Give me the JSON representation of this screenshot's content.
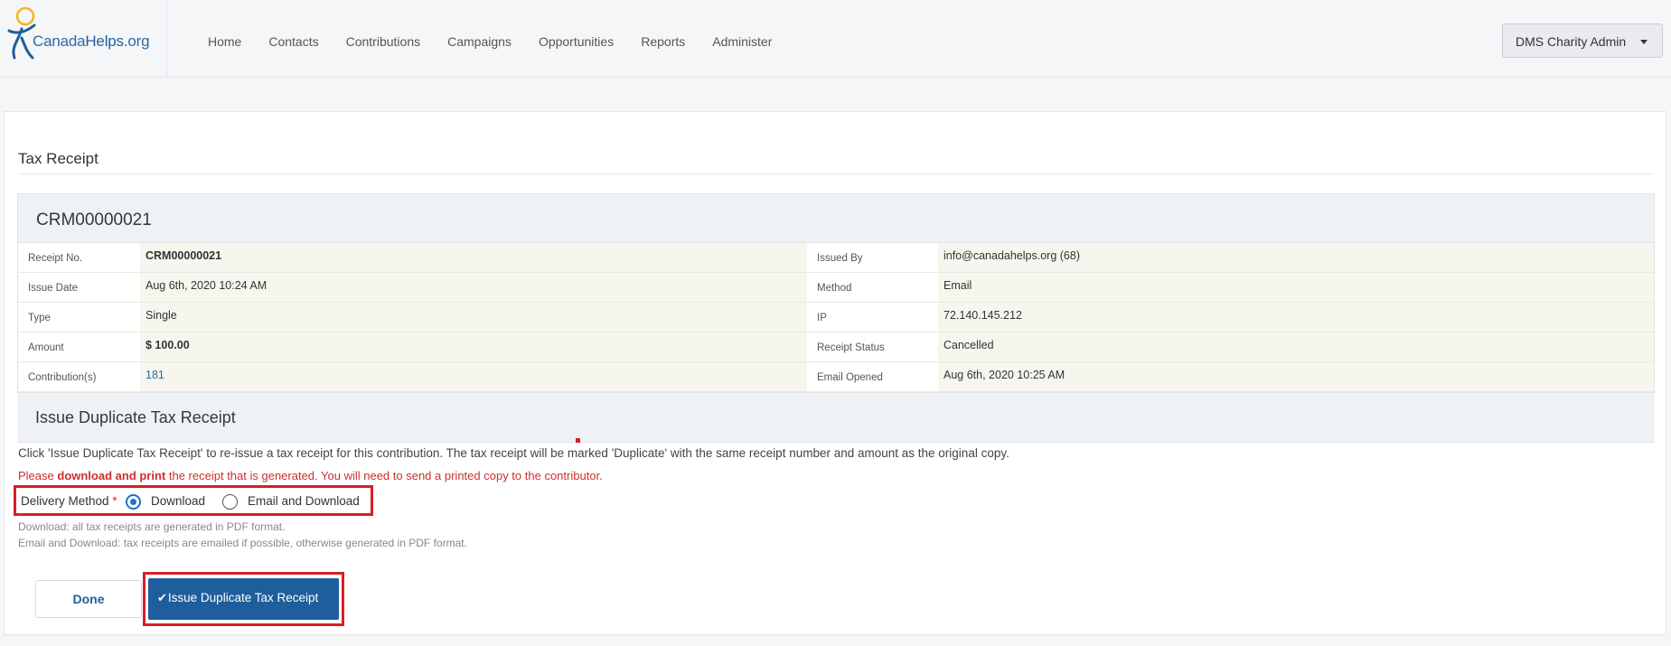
{
  "brand": {
    "logo_text_a": "Canada",
    "logo_text_b": "Helps",
    "logo_text_c": ".org"
  },
  "nav": [
    "Home",
    "Contacts",
    "Contributions",
    "Campaigns",
    "Opportunities",
    "Reports",
    "Administer"
  ],
  "user_menu": {
    "label": "DMS Charity Admin"
  },
  "page": {
    "title": "Tax Receipt"
  },
  "receipt": {
    "id": "CRM00000021",
    "rows": [
      {
        "label": "Receipt No.",
        "value": "CRM00000021",
        "label2": "Issued By",
        "value2": "info@canadahelps.org (68)"
      },
      {
        "label": "Issue Date",
        "value": "Aug 6th, 2020 10:24 AM",
        "label2": "Method",
        "value2": "Email"
      },
      {
        "label": "Type",
        "value": "Single",
        "label2": "IP",
        "value2": "72.140.145.212"
      },
      {
        "label": "Amount",
        "value": "$ 100.00",
        "label2": "Receipt Status",
        "value2": "Cancelled"
      },
      {
        "label": "Contribution(s)",
        "value": "181",
        "label2": "Email Opened",
        "value2": "Aug 6th, 2020 10:25 AM"
      }
    ]
  },
  "duplicate": {
    "title": "Issue Duplicate Tax Receipt",
    "description": "Click 'Issue Duplicate Tax Receipt' to re-issue a tax receipt for this contribution. The tax receipt will be marked 'Duplicate' with the same receipt number and amount as the original copy.",
    "warning_prefix": "Please ",
    "warning_bold": "download and print",
    "warning_suffix": " the receipt that is generated. You will need to send a printed copy to the contributor.",
    "delivery_label": "Delivery Method",
    "required_mark": "*",
    "options": [
      "Download",
      "Email and Download"
    ],
    "selected": "Download",
    "help_download": "Download: all tax receipts are generated in PDF format.",
    "help_email": "Email and Download: tax receipts are emailed if possible, otherwise generated in PDF format.",
    "done_label": "Done",
    "issue_label": "Issue Duplicate Tax Receipt"
  },
  "colors": {
    "primary": "#1f5e9c",
    "highlight": "#d61f26",
    "warning": "#c9302c"
  },
  "icons": {
    "check": "check-icon",
    "caret": "caret-down-icon",
    "logo": "canadahelps-logo-icon"
  }
}
